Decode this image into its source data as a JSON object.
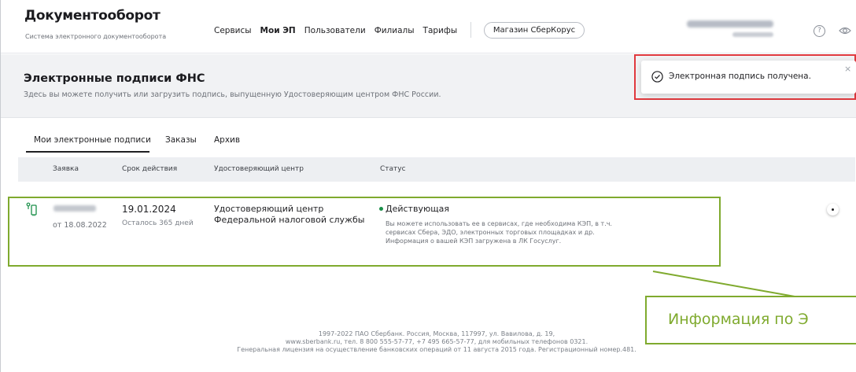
{
  "app": {
    "title": "Документооборот",
    "subtitle": "Система электронного документооборота"
  },
  "nav": {
    "items": [
      "Сервисы",
      "Мои ЭП",
      "Пользователи",
      "Филиалы",
      "Тарифы"
    ],
    "store_button": "Магазин СберКорус"
  },
  "header_icons": {
    "help": "?",
    "help_icon": "question-circle-icon",
    "eye_icon": "eye-icon"
  },
  "page": {
    "title": "Электронные подписи ФНС",
    "description": "Здесь вы можете получить или загрузить подпись, выпущенную Удостоверяющим центром ФНС России."
  },
  "toast": {
    "text": "Электронная подпись получена.",
    "close": "×",
    "icon": "check-circle-icon"
  },
  "tabs": [
    "Мои электронные подписи",
    "Заказы",
    "Архив"
  ],
  "table": {
    "columns": [
      "Заявка",
      "Срок действия",
      "Удостоверяющий центр",
      "Статус"
    ],
    "row": {
      "request_date": "от 18.08.2022",
      "valid_until": "19.01.2024",
      "days_left": "Осталось 365 дней",
      "ca_line1": "Удостоверяющий центр",
      "ca_line2": "Федеральной налоговой службы",
      "status": "Действующая",
      "status_desc_1": "Вы можете использовать ее в сервисах, где необходима КЭП, в т.ч.",
      "status_desc_2": "сервисах Сбера, ЭДО, электронных торговых площадках и др.",
      "status_desc_3": "Информация о вашей КЭП загружена в ЛК Госуслуг."
    }
  },
  "callout": {
    "text": "Информация по Э"
  },
  "footer": {
    "line1": "1997-2022 ПАО Сбербанк. Россия, Москва, 117997, ул. Вавилова, д. 19,",
    "line2": "www.sberbank.ru, тел. 8 800 555-57-77, +7 495 665-57-77, для мобильных телефонов 0321.",
    "line3": "Генеральная лицензия на осуществление банковских операций от 11 августа 2015 года. Регистрационный номер.481."
  },
  "colors": {
    "accent_green": "#7faa2e",
    "highlight_red": "#e0393e",
    "status_green": "#1a8f49"
  }
}
